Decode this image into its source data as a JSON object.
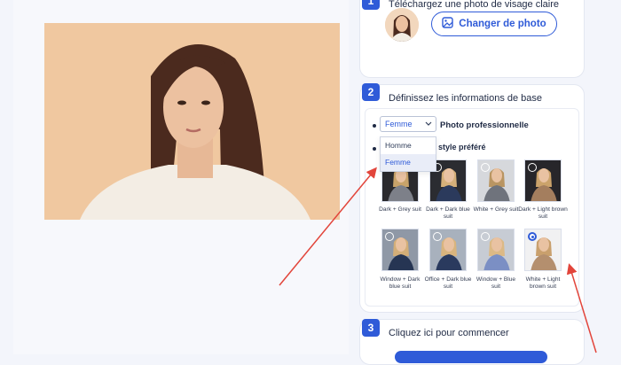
{
  "step1": {
    "number": "1",
    "title": "Téléchargez une photo de visage claire",
    "change_photo_label": "Changer de photo"
  },
  "step2": {
    "number": "2",
    "title": "Définissez les informations de base",
    "gender_select_value": "Femme",
    "gender_options": [
      "Homme",
      "Femme"
    ],
    "photo_type_label": "Photo professionnelle",
    "style_label_visible": "style préféré",
    "styles": [
      {
        "label": "Dark + Grey suit",
        "selected": false
      },
      {
        "label": "Dark + Dark blue suit",
        "selected": false
      },
      {
        "label": "White + Grey suit",
        "selected": false
      },
      {
        "label": "Dark + Light brown suit",
        "selected": false
      },
      {
        "label": "Window + Dark blue suit",
        "selected": false
      },
      {
        "label": "Office + Dark blue suit",
        "selected": false
      },
      {
        "label": "Window + Blue suit",
        "selected": false
      },
      {
        "label": "White + Light brown suit",
        "selected": true
      }
    ]
  },
  "step3": {
    "number": "3",
    "title": "Cliquez ici pour commencer"
  },
  "colors": {
    "accent": "#2f5bd8",
    "arrow": "#e2453b"
  }
}
